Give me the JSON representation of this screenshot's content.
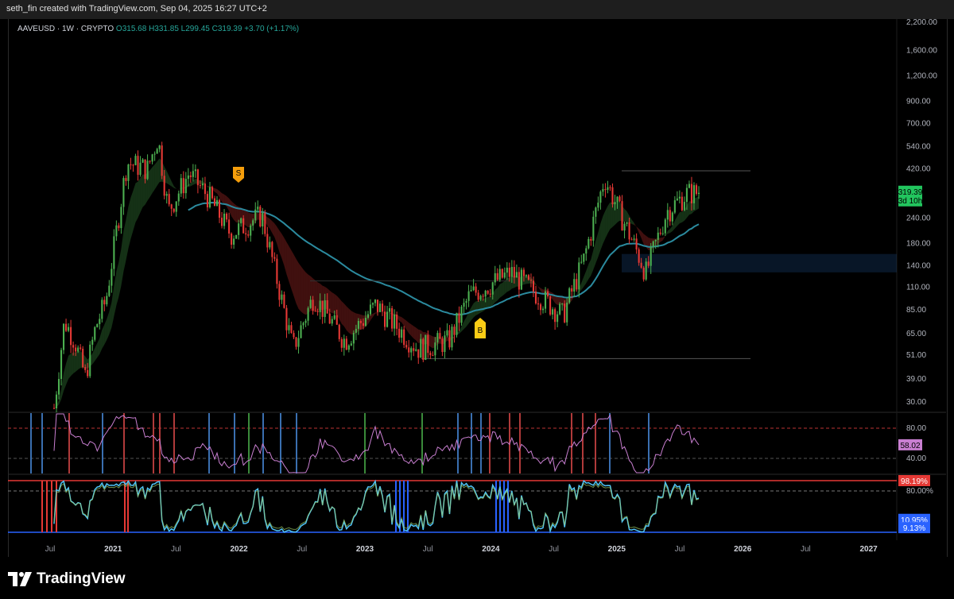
{
  "attribution": "seth_fin created with TradingView.com, Sep 04, 2025 16:27 UTC+2",
  "legend": {
    "symbol": "AAVEUSD · 1W · CRYPTO",
    "open": "O315.68",
    "high": "H331.85",
    "low": "L299.45",
    "close": "C319.39",
    "change": "+3.70 (+1.17%)"
  },
  "brand": "TradingView",
  "colors": {
    "up": "#26a69a",
    "down": "#ef5350",
    "bull_candle": "#4caf50",
    "bear_candle": "#e53935",
    "ema": "#2b8a9e",
    "rsi": "#c97fd1",
    "price_tag": "#22c55e"
  },
  "signals": {
    "sell": "S",
    "buy": "B"
  },
  "price_tag": {
    "price": "319.39",
    "countdown": "3d 10h"
  },
  "indicator_tags": {
    "rsi": "58.02",
    "stoch_top": "98.19%",
    "stoch_a": "10.95%",
    "stoch_b": "9.13%"
  },
  "chart_data": {
    "type": "candlestick",
    "symbol": "AAVEUSD",
    "interval": "1W",
    "log_scale": true,
    "y_ticks": [
      "2,200.00",
      "1,600.00",
      "1,200.00",
      "900.00",
      "700.00",
      "540.00",
      "420.00",
      "319.39",
      "240.00",
      "180.00",
      "140.00",
      "110.00",
      "85.00",
      "65.00",
      "51.00",
      "39.00",
      "30.00"
    ],
    "x_ticks": [
      "Jul",
      "2021",
      "Jul",
      "2022",
      "Jul",
      "2023",
      "Jul",
      "2024",
      "Jul",
      "2025",
      "Jul",
      "2026",
      "Jul",
      "2027"
    ],
    "last_close": 319.39,
    "price_path": [
      {
        "t": "2020-07",
        "close": 28
      },
      {
        "t": "2020-08",
        "close": 75
      },
      {
        "t": "2020-09",
        "close": 60
      },
      {
        "t": "2020-10",
        "close": 40
      },
      {
        "t": "2020-11",
        "close": 70
      },
      {
        "t": "2020-12",
        "close": 95
      },
      {
        "t": "2021-02",
        "close": 450
      },
      {
        "t": "2021-04",
        "close": 420
      },
      {
        "t": "2021-05",
        "close": 600
      },
      {
        "t": "2021-06",
        "close": 260
      },
      {
        "t": "2021-08",
        "close": 400
      },
      {
        "t": "2021-10",
        "close": 300
      },
      {
        "t": "2021-12",
        "close": 200
      },
      {
        "t": "2022-03",
        "close": 250
      },
      {
        "t": "2022-06",
        "close": 55
      },
      {
        "t": "2022-08",
        "close": 100
      },
      {
        "t": "2022-11",
        "close": 60
      },
      {
        "t": "2023-02",
        "close": 90
      },
      {
        "t": "2023-06",
        "close": 55
      },
      {
        "t": "2023-09",
        "close": 60
      },
      {
        "t": "2023-11",
        "close": 100
      },
      {
        "t": "2024-03",
        "close": 130
      },
      {
        "t": "2024-08",
        "close": 80
      },
      {
        "t": "2024-10",
        "close": 150
      },
      {
        "t": "2024-12",
        "close": 380
      },
      {
        "t": "2025-04",
        "close": 130
      },
      {
        "t": "2025-06",
        "close": 260
      },
      {
        "t": "2025-08",
        "close": 319.39
      }
    ],
    "rsi": {
      "levels": [
        80,
        40
      ],
      "last": 58.02
    },
    "stoch": {
      "levels": [
        "98.19%",
        "80.00%",
        "10.95%",
        "9.13%"
      ]
    }
  }
}
